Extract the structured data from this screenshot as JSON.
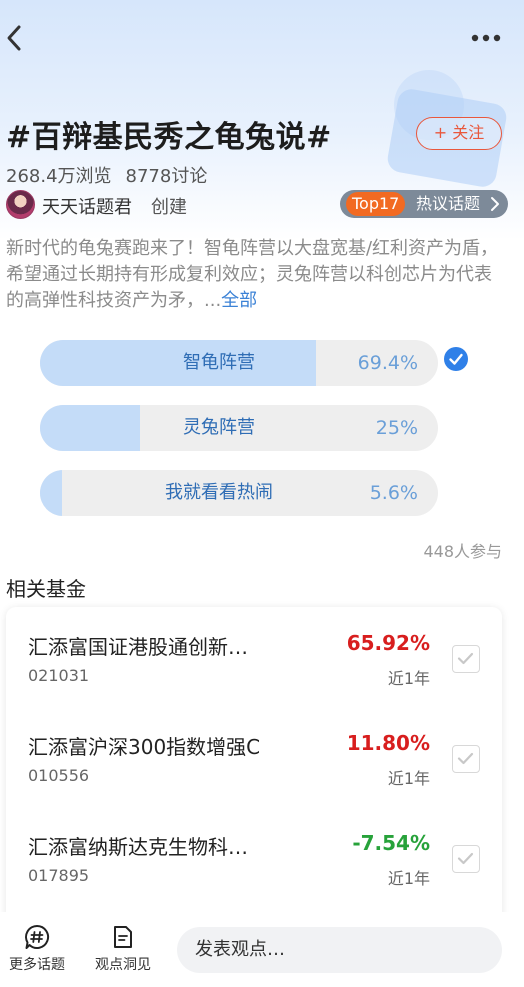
{
  "header": {
    "back_icon": "chevron-left-icon",
    "more_icon": "more-dots-icon"
  },
  "topic": {
    "title": "#百辩基民秀之龟兔说#",
    "follow_label": "+ 关注",
    "views": "268.4万浏览",
    "discussions": "8778讨论",
    "creator_name": "天天话题君",
    "creator_action": "创建",
    "hot_rank": "Top17",
    "hot_label": "热议话题",
    "description": "新时代的龟兔赛跑来了！智龟阵营以大盘宽基/红利资产为盾，希望通过长期持有形成复利效应；灵兔阵营以科创芯片为代表的高弹性科技资产为矛，...",
    "more_link": "全部"
  },
  "poll": {
    "options": [
      {
        "label": "智龟阵营",
        "percent_text": "69.4%",
        "percent": 69.4,
        "selected": true
      },
      {
        "label": "灵兔阵营",
        "percent_text": "25%",
        "percent": 25
      },
      {
        "label": "我就看看热闹",
        "percent_text": "5.6%",
        "percent": 5.6
      }
    ],
    "participants": "448人参与"
  },
  "related_funds": {
    "title": "相关基金",
    "items": [
      {
        "name": "汇添富国证港股通创新…",
        "code": "021031",
        "return": "65.92%",
        "period": "近1年",
        "color": "#d81e1e"
      },
      {
        "name": "汇添富沪深300指数增强C",
        "code": "010556",
        "return": "11.80%",
        "period": "近1年",
        "color": "#d81e1e"
      },
      {
        "name": "汇添富纳斯达克生物科…",
        "code": "017895",
        "return": "-7.54%",
        "period": "近1年",
        "color": "#27a23a"
      }
    ]
  },
  "bottom_bar": {
    "more_topics_label": "更多话题",
    "insights_label": "观点洞见",
    "comment_placeholder": "发表观点…"
  },
  "colors": {
    "accent": "#3b82d6",
    "follow": "#e9573c",
    "hot_rank": "#f26a22",
    "poll_fill": "#c4dcf8",
    "gain": "#d81e1e",
    "loss": "#27a23a"
  }
}
